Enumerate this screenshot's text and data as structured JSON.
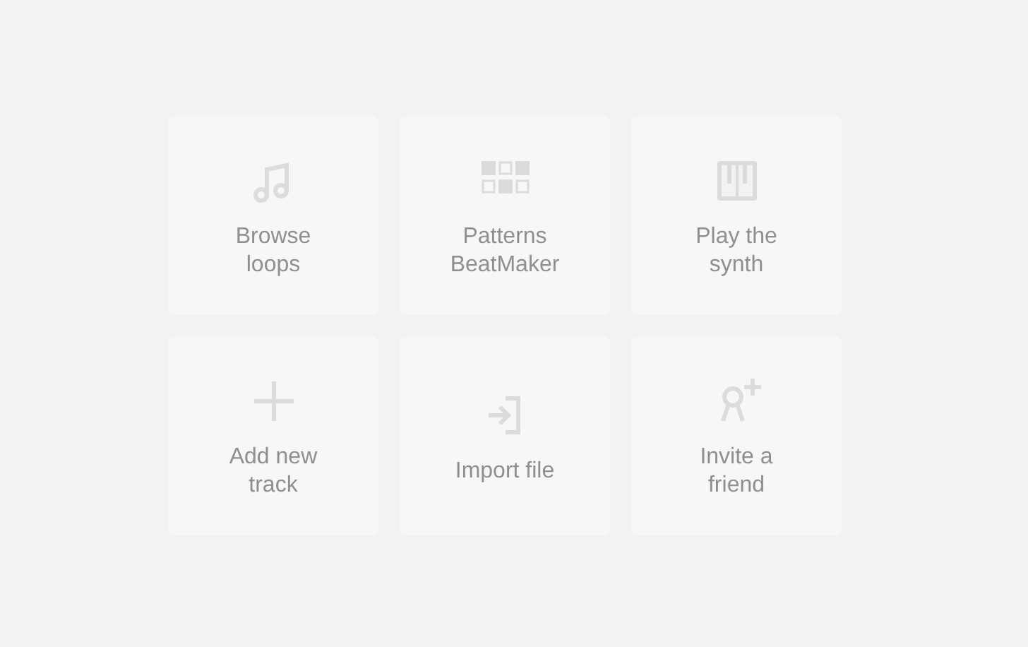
{
  "tiles": [
    {
      "label": [
        "Browse",
        "loops"
      ]
    },
    {
      "label": [
        "Patterns",
        "BeatMaker"
      ]
    },
    {
      "label": [
        "Play the",
        "synth"
      ]
    },
    {
      "label": [
        "Add new",
        "track"
      ]
    },
    {
      "label": [
        "Import file"
      ]
    },
    {
      "label": [
        "Invite a",
        "friend"
      ]
    }
  ]
}
